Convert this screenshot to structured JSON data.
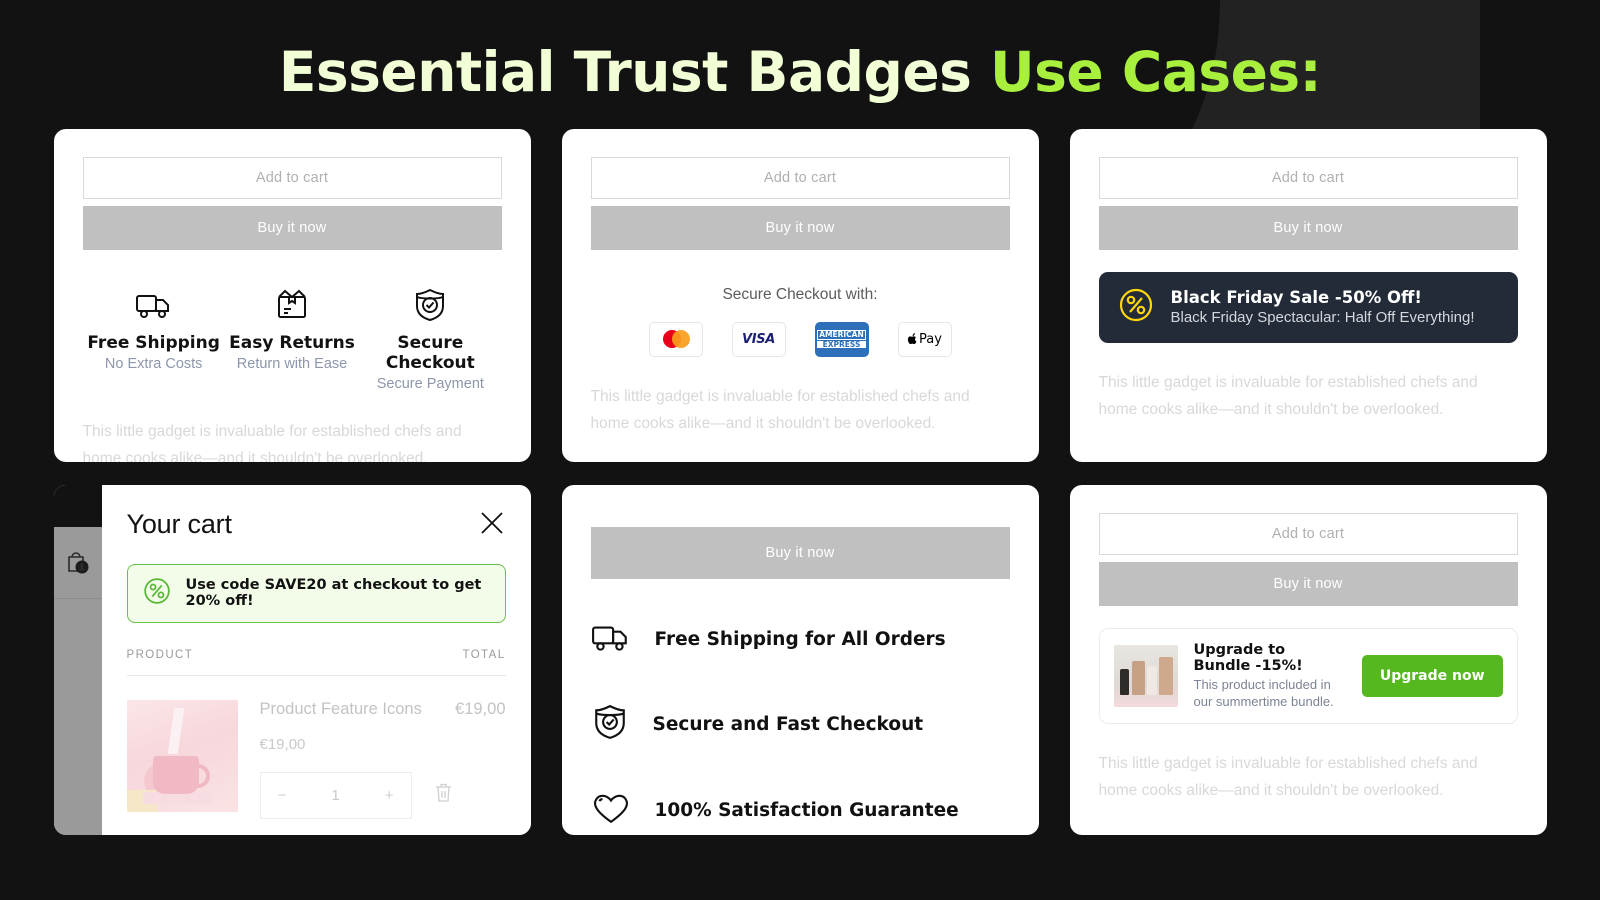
{
  "title": {
    "main": "Essential Trust Badges ",
    "accent": "Use Cases:"
  },
  "common": {
    "add_to_cart": "Add to cart",
    "buy_it_now": "Buy it now",
    "description": "This little gadget is invaluable for established chefs and home cooks alike—and it shouldn't be overlooked."
  },
  "card1": {
    "badges": [
      {
        "icon": "truck-icon",
        "title": "Free Shipping",
        "subtitle": "No Extra Costs"
      },
      {
        "icon": "box-return-icon",
        "title": "Easy Returns",
        "subtitle": "Return with Ease"
      },
      {
        "icon": "shield-check-icon",
        "title": "Secure Checkout",
        "subtitle": "Secure Payment"
      }
    ]
  },
  "card2": {
    "payments_label": "Secure Checkout with:",
    "payments": [
      {
        "name": "mastercard-logo",
        "label": "Mastercard"
      },
      {
        "name": "visa-logo",
        "label": "VISA"
      },
      {
        "name": "amex-logo",
        "label_top": "AMERICAN",
        "label_bottom": "EXPRESS"
      },
      {
        "name": "apple-pay-logo",
        "label": "Pay"
      }
    ]
  },
  "card3": {
    "banner": {
      "icon": "percent-circle-icon",
      "title": "Black Friday Sale -50% Off!",
      "subtitle": "Black Friday Spectacular: Half Off Everything!",
      "background_color": "#222b37",
      "icon_color": "#ffd60a"
    }
  },
  "card4": {
    "drawer_title": "Your cart",
    "close_icon": "close-icon",
    "cart_badge_count": "1",
    "promo": {
      "icon": "percent-circle-icon",
      "text": "Use code SAVE20 at checkout to get 20% off!",
      "border_color": "#6cc04a",
      "background_color": "#f3fce9"
    },
    "columns": {
      "product": "PRODUCT",
      "total": "TOTAL"
    },
    "item": {
      "name": "Product Feature Icons",
      "total": "€19,00",
      "price": "€19,00",
      "quantity": "1",
      "minus": "−",
      "plus": "+",
      "remove_icon": "trash-icon"
    }
  },
  "card5": {
    "features": [
      {
        "icon": "truck-icon",
        "label": "Free Shipping for All Orders"
      },
      {
        "icon": "shield-check-icon",
        "label": "Secure and Fast Checkout"
      },
      {
        "icon": "heart-icon",
        "label": "100% Satisfaction Guarantee"
      }
    ]
  },
  "card6": {
    "upsell": {
      "title": "Upgrade to Bundle -15%!",
      "subtitle": "This product included in our summertime bundle.",
      "button": "Upgrade now",
      "button_color": "#56b81f"
    }
  }
}
